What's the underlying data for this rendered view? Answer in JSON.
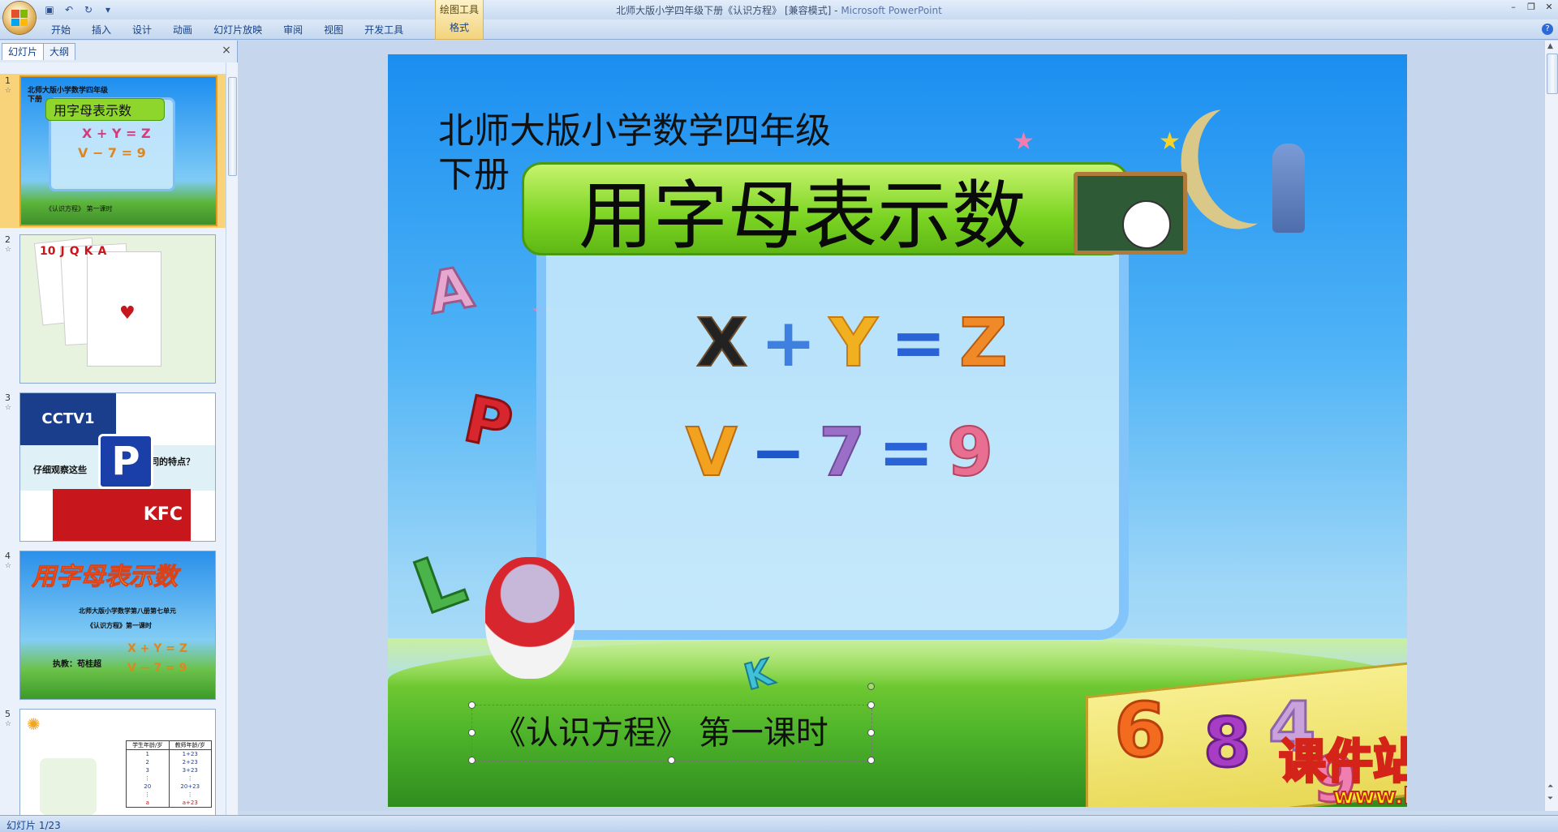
{
  "window": {
    "title": "北师大版小学四年级下册《认识方程》 [兼容模式] - ",
    "app": "Microsoft PowerPoint",
    "context_tab_group": "绘图工具"
  },
  "ribbon": {
    "tabs": [
      "开始",
      "插入",
      "设计",
      "动画",
      "幻灯片放映",
      "审阅",
      "视图",
      "开发工具"
    ],
    "context_tab": "格式"
  },
  "panel": {
    "tab_slides": "幻灯片",
    "tab_outline": "大纲",
    "close_glyph": "×"
  },
  "thumbnails": [
    {
      "num": "1",
      "title": "用字母表示数",
      "line1": "北师大版小学数学四年级",
      "line2": "下册",
      "eq1": "X + Y = Z",
      "eq2": "V − 7 = 9",
      "foot": "《认识方程》 第一课时"
    },
    {
      "num": "2",
      "cards": [
        "10",
        "J",
        "Q",
        "K",
        "A"
      ]
    },
    {
      "num": "3",
      "logo": "CCTV1",
      "p": "P",
      "kfc": "KFC",
      "q1": "仔细观察这些",
      "q2": "同的特点？"
    },
    {
      "num": "4",
      "title": "用字母表示数",
      "line1": "北师大版小学数学第八册第七单元",
      "line2": "《认识方程》第一课时",
      "author": "执教：苟桂超",
      "eq1": "X + Y = Z",
      "eq2": "V − 7 = 9"
    },
    {
      "num": "5",
      "h1": "学生年龄/岁",
      "h2": "教师年龄/岁",
      "col1": [
        "1",
        "2",
        "3",
        "⋮",
        "20",
        "⋮",
        "a"
      ],
      "col2": [
        "1+23",
        "2+23",
        "3+23",
        "⋮",
        "20+23",
        "⋮",
        "a+23"
      ]
    }
  ],
  "slide": {
    "subtitle_line1": "北师大版小学数学四年级",
    "subtitle_line2": "下册",
    "title": "用字母表示数",
    "eq1": [
      "X",
      "+",
      "Y",
      "=",
      "Z"
    ],
    "eq2": [
      "V",
      "−",
      "7",
      "=",
      "9"
    ],
    "footer": "《认识方程》 第一课时",
    "letters": [
      "A",
      "P",
      "L",
      "K"
    ],
    "book_digits": [
      "6",
      "8",
      "4",
      "9"
    ],
    "watermark": "课件站",
    "watermark_url": "www.kjzhan.com"
  },
  "status": {
    "slide_info": "幻灯片 1/23"
  },
  "colors": {
    "x": "#222222",
    "plus": "#3f7fe0",
    "y": "#f0b020",
    "equals": "#2a63d6",
    "z": "#f08a28",
    "v": "#f2a21e",
    "minus": "#1f56c8",
    "seven": "#9b6fc8",
    "nine": "#e86f92"
  }
}
